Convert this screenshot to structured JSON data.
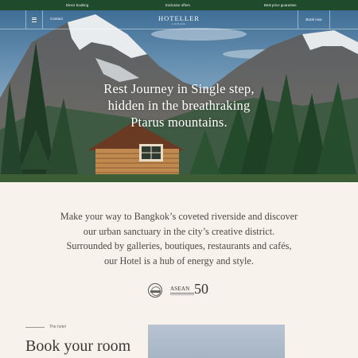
{
  "topbar": {
    "direct_booking": "Direct booking",
    "exclusive_offers": "Exclusive offers",
    "best_price": "Best price guarantee",
    "bg_color": "#1f4a2c"
  },
  "nav": {
    "menu_icon": "hamburger-icon",
    "contact": "Contact",
    "logo_name": "HOTELLER",
    "logo_sub": "LODGE",
    "book_now": "Book now"
  },
  "hero": {
    "headline_line1": "Rest Journey in Single step,",
    "headline_line2": "hidden in the breathraking",
    "headline_line3": "Ptarus mountains."
  },
  "intro": {
    "line1": "Make your way to Bangkok’s coveted riverside and discover",
    "line2": "our urban sanctuary in the city’s creative district.",
    "line3": "Surrounded by galleries, boutiques, restaurants and cafés,",
    "line4": "our Hotel is a hub of energy and style."
  },
  "awards": {
    "seal_icon": "award-seal-icon",
    "asean_text": "ASEAN",
    "asean_number": "50"
  },
  "hotel_section": {
    "label": "The hotel",
    "title": "Book your room"
  }
}
